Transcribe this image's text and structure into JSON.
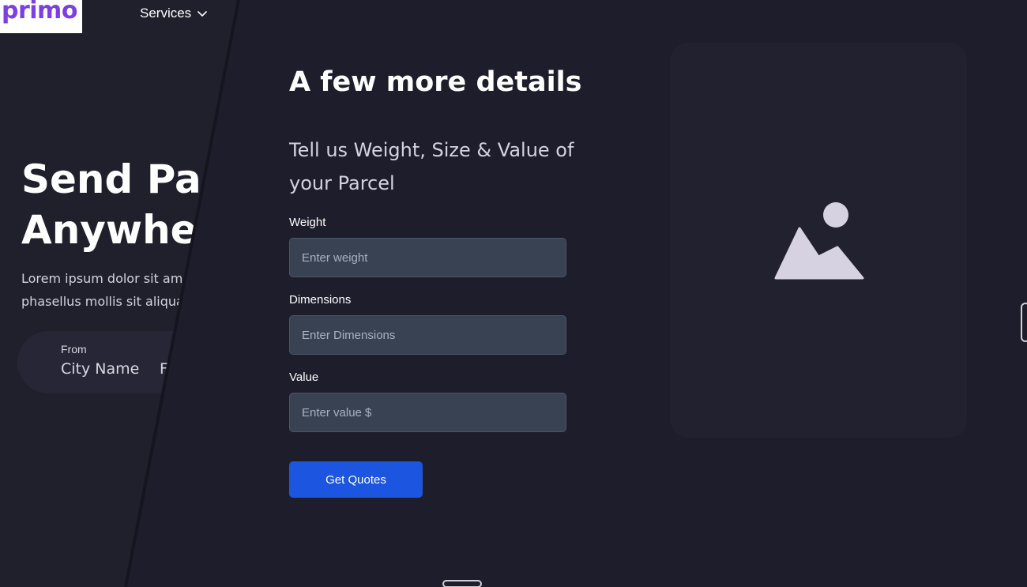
{
  "header": {
    "logo": "primo",
    "nav_services": "Services",
    "chevron_icon": "chevron-down-icon"
  },
  "hero": {
    "title_line1": "Send Par",
    "title_line2": "Anywher",
    "text_line1": "Lorem ipsum dolor sit amo",
    "text_line2": "phasellus mollis sit aliqua",
    "from_label": "From",
    "from_value": "City Name",
    "next_fragment": "F"
  },
  "modal": {
    "title": "A few more details",
    "subtitle": "Tell us Weight, Size & Value of your Parcel",
    "fields": [
      {
        "label": "Weight",
        "placeholder": "Enter weight"
      },
      {
        "label": "Dimensions",
        "placeholder": "Enter Dimensions"
      },
      {
        "label": "Value",
        "placeholder": "Enter value $"
      }
    ],
    "submit_label": "Get Quotes",
    "image_placeholder_icon": "image-placeholder-icon"
  },
  "colors": {
    "background": "#1e1d2b",
    "input_bg": "#394253",
    "button_bg": "#1c55e0",
    "logo": "#7b3fe4"
  }
}
